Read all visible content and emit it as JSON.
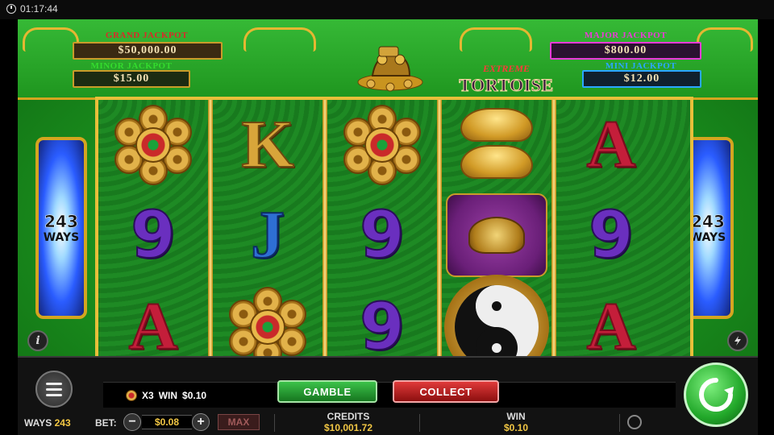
{
  "status_bar": {
    "time": "01:17:44"
  },
  "jackpots": {
    "grand": {
      "label": "GRAND JACKPOT",
      "value": "$50,000.00"
    },
    "major": {
      "label": "MAJOR JACKPOT",
      "value": "$800.00"
    },
    "minor": {
      "label": "MINOR JACKPOT",
      "value": "$15.00"
    },
    "mini": {
      "label": "MINI JACKPOT",
      "value": "$12.00"
    }
  },
  "logo": {
    "top": "EXTREME",
    "main": "TORTOISE"
  },
  "ways_pillar": {
    "count": "243",
    "label": "WAYS"
  },
  "reels": [
    [
      "coin-flower",
      "9",
      "A"
    ],
    [
      "K",
      "J",
      "coin-flower"
    ],
    [
      "coin-flower",
      "9",
      "9"
    ],
    [
      "gold-ingots",
      "tortoise",
      "yin-yang"
    ],
    [
      "A",
      "9",
      "A"
    ]
  ],
  "info_button": "i",
  "result": {
    "multiplier": "X3",
    "win_label": "WIN",
    "win_value": "$0.10"
  },
  "buttons": {
    "gamble": "GAMBLE",
    "collect": "COLLECT",
    "max": "MAX",
    "minus": "−",
    "plus": "+"
  },
  "footer": {
    "ways_label": "WAYS",
    "ways_value": "243",
    "bet_label": "BET:",
    "bet_value": "$0.08",
    "credits_label": "CREDITS",
    "credits_value": "$10,001.72",
    "win_label": "WIN",
    "win_value": "$0.10"
  },
  "colors": {
    "felt_green": "#1b8f1e",
    "gold": "#d4a520",
    "gamble_green": "#3cc24a",
    "collect_red": "#e03a3a",
    "value_gold": "#f2c744"
  }
}
